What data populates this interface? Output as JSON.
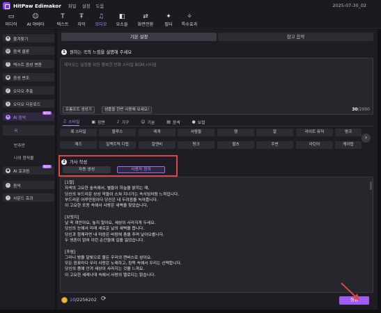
{
  "app": {
    "name": "HitPaw Edimakor",
    "menus": [
      "파일",
      "설정",
      "도움"
    ],
    "date": "2025-07-30_02"
  },
  "toolbar": [
    {
      "label": "미디어",
      "icon": "folder-icon"
    },
    {
      "label": "AI 아바타",
      "icon": "avatar-icon"
    },
    {
      "label": "텍스트",
      "icon": "text-icon"
    },
    {
      "label": "자막",
      "icon": "subtitle-icon"
    },
    {
      "label": "오디오",
      "icon": "music-note-icon",
      "active": true
    },
    {
      "label": "요소들",
      "icon": "elements-icon"
    },
    {
      "label": "화면전환",
      "icon": "transition-icon"
    },
    {
      "label": "필터",
      "icon": "filter-icon"
    },
    {
      "label": "특수효과",
      "icon": "effects-icon"
    }
  ],
  "sidebar": {
    "items": [
      {
        "label": "즐겨찾기"
      },
      {
        "label": "음색 클론"
      },
      {
        "label": "텍스트 음성 변환"
      },
      {
        "label": "음성 변조"
      },
      {
        "label": "오디오 추출"
      },
      {
        "label": "오디오 다운로드"
      },
      {
        "label": "AI 음악",
        "badge": "NEW"
      }
    ],
    "sub_items": [
      "곡",
      "반주만",
      "나의 창작물"
    ],
    "items2": [
      {
        "label": "AI 효과음",
        "badge": "NEW"
      },
      {
        "label": "음악"
      },
      {
        "label": "사운드 효과"
      }
    ]
  },
  "mode_tabs": [
    "기본 설정",
    "참고 음악"
  ],
  "section1": {
    "number": "1",
    "title": "원하는 곡의 느낌을 설명해 주세요",
    "placeholder": "재미있는 실험을 위한 행복한 만화 스타일 BGM,시티팝",
    "chips": [
      "프롬프트 생성기",
      "샘플을 한번 사용해 보세요!"
    ],
    "counter_current": "30",
    "counter_max": "/2000"
  },
  "style_tabs": [
    {
      "label": "스타일",
      "icon": "music-note-icon",
      "active": true
    },
    {
      "label": "장면",
      "icon": "scene-icon"
    },
    {
      "label": "기구",
      "icon": "guitar-icon"
    },
    {
      "label": "기분",
      "icon": "mood-icon"
    },
    {
      "label": "음색",
      "icon": "voice-icon"
    },
    {
      "label": "보컬",
      "icon": "vocal-icon"
    }
  ],
  "tags_row1": [
    "록 스타일",
    "블루스",
    "레게",
    "사람들",
    "잼",
    "알",
    "라이트 뮤직",
    "펑크"
  ],
  "tags_row2": [
    "재즈",
    "일렉트릭 디랩",
    "알앤비",
    "펑크",
    "왈츠",
    "주변",
    "라틴어",
    "케이팝"
  ],
  "section2": {
    "number": "2",
    "title": "가사 작성",
    "auto_label": "자동 생성",
    "custom_label": "사용자 정의"
  },
  "lyrics": [
    "[1절]",
    "자색의 고요한 숲속에서, 별들이 하늘을 밝히는 때,",
    "당신의 부드러운 상상 막들이 스쳐 지나가는 속삭임처럼 느껴집니다.",
    "부드러운 어루만짐이다 당신은 내 두려움을 녹여줍니다.",
    "이 고요한 포옹 속에서 사랑은 새벽을 찾았습니다.",
    "",
    "[브릿지]",
    "날 꼭 껴안아요, 놓지 말아요, 세상이 사라지게 두세요.",
    "당신의 눈에서 미래 새로운 날의 새벽을 봅니다.",
    "당신과 함께라면 내 마음은 바람에 춤을 추며 날아오릅니다.",
    "두 영혼이 얽혀 이런 순간들에 길을 잃었습니다.",
    "",
    "[후렴]",
    "그러니 밤을 달빛으로 물든 우리의 캔버스로 삼아요.",
    "모든 음표마다 우리 사랑은 노래하고, 침묵 속에서 우리는 선택합니다.",
    "당신의 품에 안겨 세상이 사라지는 것을 느껴요.",
    "이 고요한 세레나데 속에서 사랑의 멜로디는 맑습니다."
  ],
  "bottom": {
    "credits_used": "10",
    "credits_total": "/2256202",
    "generate_label": "생성"
  },
  "colors": {
    "accent": "#a05cf0",
    "highlight": "#d94848"
  }
}
